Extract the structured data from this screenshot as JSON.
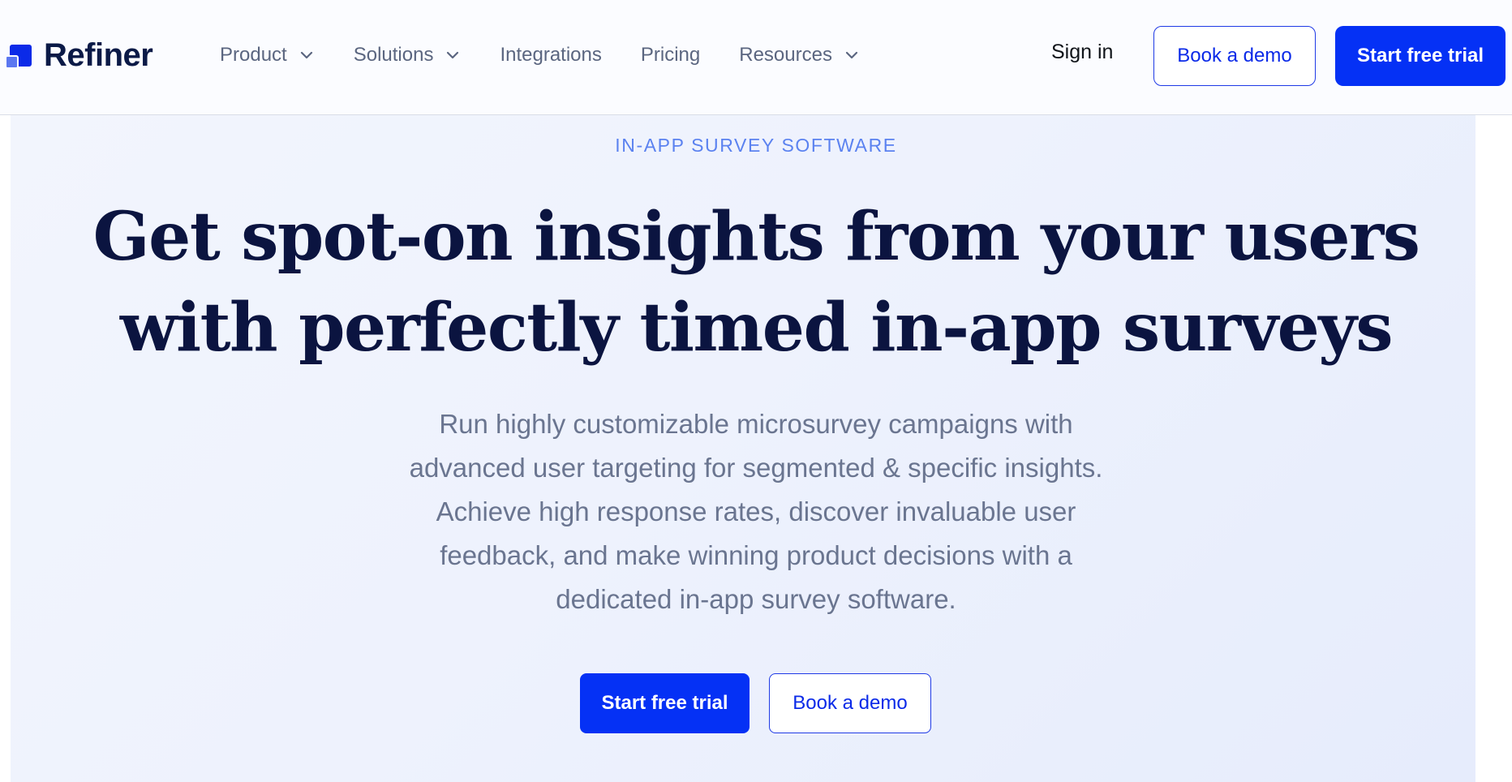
{
  "header": {
    "logo_text": "Refiner",
    "nav": [
      {
        "label": "Product",
        "has_dropdown": true
      },
      {
        "label": "Solutions",
        "has_dropdown": true
      },
      {
        "label": "Integrations",
        "has_dropdown": false
      },
      {
        "label": "Pricing",
        "has_dropdown": false
      },
      {
        "label": "Resources",
        "has_dropdown": true
      }
    ],
    "sign_in_label": "Sign in",
    "book_demo_label": "Book a demo",
    "start_trial_label": "Start free trial"
  },
  "hero": {
    "eyebrow": "IN-APP SURVEY SOFTWARE",
    "headline_line1": "Get spot-on insights from your users",
    "headline_line2": "with perfectly timed in-app surveys",
    "subtext_lines": [
      "Run highly customizable microsurvey campaigns with",
      "advanced user targeting for segmented & specific insights.",
      "Achieve high response rates, discover invaluable user",
      "feedback, and make winning product decisions with a",
      "dedicated in-app survey software."
    ],
    "primary_cta": "Start free trial",
    "secondary_cta": "Book a demo"
  },
  "colors": {
    "brand_blue": "#0531f5",
    "navy_text": "#0b1440",
    "muted_text": "#6a7590",
    "eyebrow_blue": "#5b82f0",
    "hero_bg": "#eef2fd"
  },
  "icons": {
    "logo": "refiner-logo-squares-icon",
    "dropdown": "chevron-down-icon"
  }
}
